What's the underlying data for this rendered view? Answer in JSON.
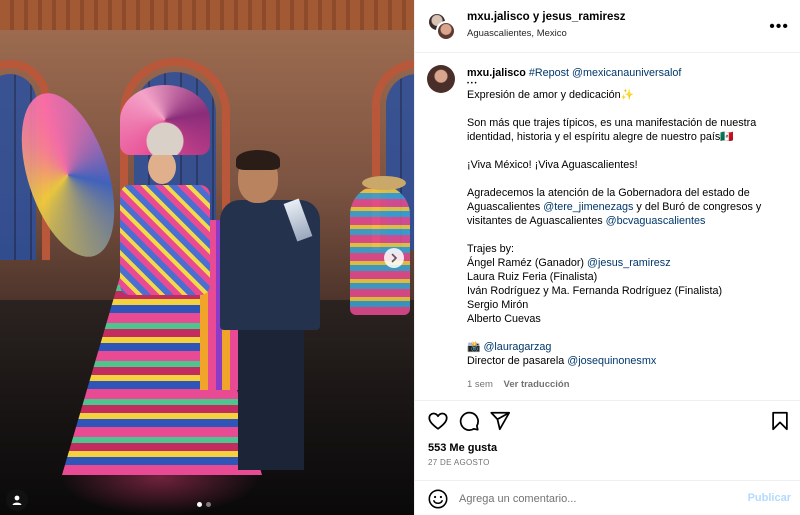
{
  "post": {
    "header": {
      "username_line": "mxu.jalisco y jesus_ramiresz",
      "location": "Aguascalientes, Mexico",
      "more_icon": "more-horizontal-icon",
      "more_label": "•••"
    },
    "caption": {
      "username": "mxu.jalisco",
      "repost": "#Repost",
      "repost_source": "@mexicanauniversalof",
      "dots": "• • •",
      "line1_text": "Expresión de amor y dedicación",
      "line1_emoji": "✨",
      "para2_text": "Son más que trajes típicos, es una manifestación de nuestra identidad, historia y el espíritu alegre de nuestro país",
      "para2_flag": "🇲🇽",
      "viva": "¡Viva México! ¡Viva Aguascalientes!",
      "thanks_a": "Agradecemos la atención de la Gobernadora del estado de Aguascalientes",
      "thanks_mention1": "@tere_jimenezags",
      "thanks_b": "y del Buró de congresos y visitantes de Aguascalientes",
      "thanks_mention2": "@bcvaguascalientes",
      "trajes_heading": "Trajes by:",
      "trajes_1_text": "Ángel Raméz (Ganador)",
      "trajes_1_mention": "@jesus_ramiresz",
      "trajes_2": "Laura Ruiz Feria (Finalista)",
      "trajes_3": "Iván Rodríguez y Ma. Fernanda Rodríguez (Finalista)",
      "trajes_4": "Sergio Mirón",
      "trajes_5": "Alberto Cuevas",
      "camera_emoji": "📸",
      "photo_mention": "@lauragarzag",
      "director_text": "Director de pasarela",
      "director_mention": "@josequinonesmx"
    },
    "meta": {
      "age": "1 sem",
      "translate": "Ver traducción"
    },
    "actions": {
      "icons": [
        "heart-icon",
        "comment-icon",
        "share-icon",
        "bookmark-icon"
      ]
    },
    "likes": "553 Me gusta",
    "date": "27 DE AGOSTO",
    "comment": {
      "placeholder": "Agrega un comentario...",
      "value": "",
      "publish": "Publicar"
    },
    "carousel": {
      "slides": 2,
      "active": 1,
      "next_icon": "chevron-right-icon",
      "tag_icon": "user-tag-icon"
    },
    "colors": {
      "link": "#00376b",
      "muted": "#737373",
      "publish_disabled": "#b3dbff",
      "border": "#efefef"
    }
  }
}
